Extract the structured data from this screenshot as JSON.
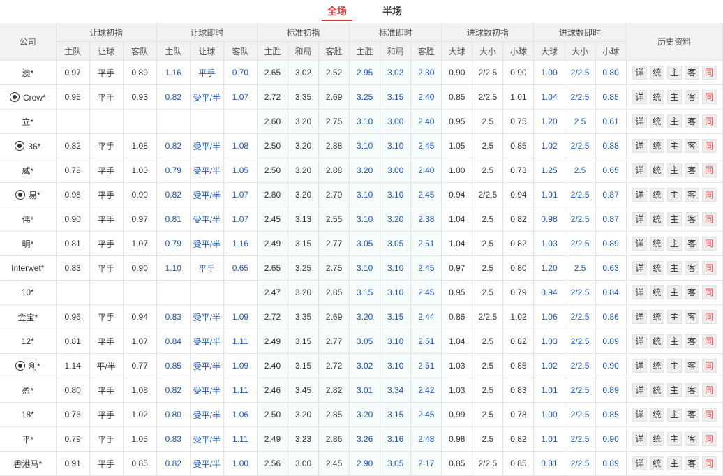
{
  "tabs": [
    "全场",
    "半场"
  ],
  "headers": {
    "company": "公司",
    "groups": [
      "让球初指",
      "让球即时",
      "标准初指",
      "标准即时",
      "进球数初指",
      "进球数即时"
    ],
    "history": "历史资料",
    "sub": [
      "主队",
      "让球",
      "客队",
      "主队",
      "让球",
      "客队",
      "主胜",
      "和局",
      "客胜",
      "主胜",
      "和局",
      "客胜",
      "大球",
      "大小",
      "小球",
      "大球",
      "大小",
      "小球"
    ]
  },
  "links": [
    "详",
    "统",
    "主",
    "客",
    "同"
  ],
  "rows": [
    {
      "name": "澳*",
      "icon": false,
      "c": [
        "0.97",
        "平手",
        "0.89",
        "1.16",
        "平手",
        "0.70",
        "2.65",
        "3.02",
        "2.52",
        "2.95",
        "3.02",
        "2.30",
        "0.90",
        "2/2.5",
        "0.90",
        "1.00",
        "2/2.5",
        "0.80"
      ]
    },
    {
      "name": "Crow*",
      "icon": true,
      "c": [
        "0.95",
        "平手",
        "0.93",
        "0.82",
        "受平/半",
        "1.07",
        "2.72",
        "3.35",
        "2.69",
        "3.25",
        "3.15",
        "2.40",
        "0.85",
        "2/2.5",
        "1.01",
        "1.04",
        "2/2.5",
        "0.85"
      ]
    },
    {
      "name": "立*",
      "icon": false,
      "c": [
        "",
        "",
        "",
        "",
        "",
        "",
        "2.60",
        "3.20",
        "2.75",
        "3.10",
        "3.00",
        "2.40",
        "0.95",
        "2.5",
        "0.75",
        "1.20",
        "2.5",
        "0.61"
      ]
    },
    {
      "name": "36*",
      "icon": true,
      "c": [
        "0.82",
        "平手",
        "1.08",
        "0.82",
        "受平/半",
        "1.08",
        "2.50",
        "3.20",
        "2.88",
        "3.10",
        "3.10",
        "2.45",
        "1.05",
        "2.5",
        "0.85",
        "1.02",
        "2/2.5",
        "0.88"
      ]
    },
    {
      "name": "威*",
      "icon": false,
      "c": [
        "0.78",
        "平手",
        "1.03",
        "0.79",
        "受平/半",
        "1.05",
        "2.50",
        "3.20",
        "2.88",
        "3.20",
        "3.00",
        "2.40",
        "1.00",
        "2.5",
        "0.73",
        "1.25",
        "2.5",
        "0.65"
      ]
    },
    {
      "name": "易*",
      "icon": true,
      "c": [
        "0.98",
        "平手",
        "0.90",
        "0.82",
        "受平/半",
        "1.07",
        "2.80",
        "3.20",
        "2.70",
        "3.10",
        "3.10",
        "2.45",
        "0.94",
        "2/2.5",
        "0.94",
        "1.01",
        "2/2.5",
        "0.87"
      ]
    },
    {
      "name": "伟*",
      "icon": false,
      "c": [
        "0.90",
        "平手",
        "0.97",
        "0.81",
        "受平/半",
        "1.07",
        "2.45",
        "3.13",
        "2.55",
        "3.10",
        "3.20",
        "2.38",
        "1.04",
        "2.5",
        "0.82",
        "0.98",
        "2/2.5",
        "0.87"
      ]
    },
    {
      "name": "明*",
      "icon": false,
      "c": [
        "0.81",
        "平手",
        "1.07",
        "0.79",
        "受平/半",
        "1.16",
        "2.49",
        "3.15",
        "2.77",
        "3.05",
        "3.05",
        "2.51",
        "1.04",
        "2.5",
        "0.82",
        "1.03",
        "2/2.5",
        "0.89"
      ]
    },
    {
      "name": "Interwet*",
      "icon": false,
      "c": [
        "0.83",
        "平手",
        "0.90",
        "1.10",
        "平手",
        "0.65",
        "2.65",
        "3.25",
        "2.75",
        "3.10",
        "3.10",
        "2.45",
        "0.97",
        "2.5",
        "0.80",
        "1.20",
        "2.5",
        "0.63"
      ]
    },
    {
      "name": "10*",
      "icon": false,
      "c": [
        "",
        "",
        "",
        "",
        "",
        "",
        "2.47",
        "3.20",
        "2.85",
        "3.15",
        "3.10",
        "2.45",
        "0.95",
        "2.5",
        "0.79",
        "0.94",
        "2/2.5",
        "0.84"
      ]
    },
    {
      "name": "金宝*",
      "icon": false,
      "c": [
        "0.96",
        "平手",
        "0.94",
        "0.83",
        "受平/半",
        "1.09",
        "2.72",
        "3.35",
        "2.69",
        "3.20",
        "3.15",
        "2.44",
        "0.86",
        "2/2.5",
        "1.02",
        "1.06",
        "2/2.5",
        "0.86"
      ]
    },
    {
      "name": "12*",
      "icon": false,
      "c": [
        "0.81",
        "平手",
        "1.07",
        "0.84",
        "受平/半",
        "1.11",
        "2.49",
        "3.15",
        "2.77",
        "3.05",
        "3.10",
        "2.51",
        "1.04",
        "2.5",
        "0.82",
        "1.03",
        "2/2.5",
        "0.89"
      ]
    },
    {
      "name": "利*",
      "icon": true,
      "c": [
        "1.14",
        "平/半",
        "0.77",
        "0.85",
        "受平/半",
        "1.09",
        "2.40",
        "3.15",
        "2.72",
        "3.02",
        "3.10",
        "2.51",
        "1.03",
        "2.5",
        "0.85",
        "1.02",
        "2/2.5",
        "0.90"
      ]
    },
    {
      "name": "盈*",
      "icon": false,
      "c": [
        "0.80",
        "平手",
        "1.08",
        "0.82",
        "受平/半",
        "1.11",
        "2.46",
        "3.45",
        "2.82",
        "3.01",
        "3.34",
        "2.42",
        "1.03",
        "2.5",
        "0.83",
        "1.01",
        "2/2.5",
        "0.89"
      ]
    },
    {
      "name": "18*",
      "icon": false,
      "c": [
        "0.76",
        "平手",
        "1.02",
        "0.80",
        "受平/半",
        "1.06",
        "2.50",
        "3.20",
        "2.85",
        "3.20",
        "3.15",
        "2.45",
        "0.99",
        "2.5",
        "0.78",
        "1.00",
        "2/2.5",
        "0.85"
      ]
    },
    {
      "name": "平*",
      "icon": false,
      "c": [
        "0.79",
        "平手",
        "1.05",
        "0.83",
        "受平/半",
        "1.11",
        "2.49",
        "3.23",
        "2.86",
        "3.26",
        "3.16",
        "2.48",
        "0.98",
        "2.5",
        "0.82",
        "1.01",
        "2/2.5",
        "0.90"
      ]
    },
    {
      "name": "香港马*",
      "icon": false,
      "c": [
        "0.91",
        "平手",
        "0.85",
        "0.82",
        "受平/半",
        "1.00",
        "2.56",
        "3.00",
        "2.45",
        "2.90",
        "3.05",
        "2.17",
        "0.85",
        "2/2.5",
        "0.85",
        "0.81",
        "2/2.5",
        "0.89"
      ]
    }
  ]
}
